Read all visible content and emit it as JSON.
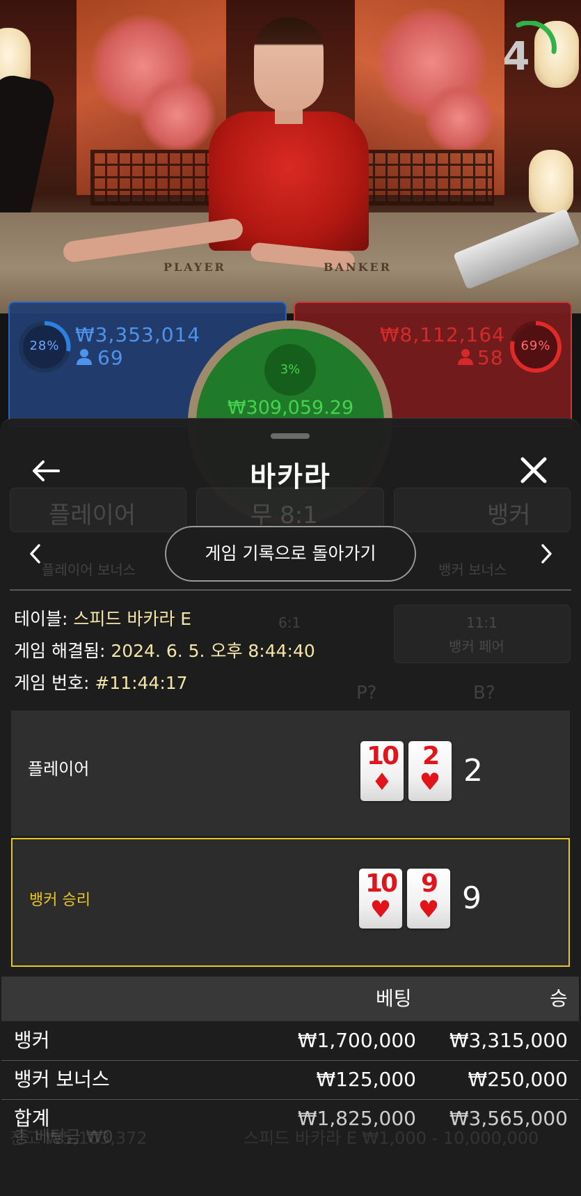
{
  "video": {
    "timer": "4",
    "table_labels": {
      "player": "PLAYER",
      "banker": "BANKER"
    }
  },
  "bet_panels": {
    "player": {
      "percent": "28%",
      "amount": "₩3,353,014",
      "players": "69"
    },
    "banker": {
      "percent": "69%",
      "amount": "₩8,112,164",
      "players": "58"
    },
    "tie": {
      "percent": "3%",
      "amount": "₩309,059.29"
    }
  },
  "sheet": {
    "title": "바카라",
    "history_button": "게임 기록으로 돌아가기",
    "table_info": {
      "table_label": "테이블:",
      "table_value": "스피드 바카라 E",
      "resolved_label": "게임 해결됨:",
      "resolved_value": "2024. 6. 5. 오후 8:44:40",
      "number_label": "게임 번호:",
      "number_value": "#11:44:17"
    },
    "player_result": {
      "label": "플레이어",
      "cards": [
        {
          "rank": "10",
          "suit": "♦"
        },
        {
          "rank": "2",
          "suit": "♥"
        }
      ],
      "score": "2"
    },
    "banker_result": {
      "label": "뱅커 승리",
      "cards": [
        {
          "rank": "10",
          "suit": "♥"
        },
        {
          "rank": "9",
          "suit": "♥"
        }
      ],
      "score": "9"
    },
    "bets_table": {
      "headers": {
        "bet": "베팅",
        "win": "승"
      },
      "rows": [
        {
          "name": "뱅커",
          "bet": "₩1,700,000",
          "win": "₩3,315,000"
        },
        {
          "name": "뱅커 보너스",
          "bet": "₩125,000",
          "win": "₩250,000"
        }
      ],
      "total": {
        "name": "합계",
        "bet": "₩1,825,000",
        "win": "₩3,565,000"
      }
    }
  },
  "background_ghost": {
    "player": "플레이어",
    "tie": "무 8:1",
    "banker": "뱅커",
    "player_bonus": "플레이어 보너스",
    "banker_bonus": "뱅커 보너스",
    "banker_pair_odds": "11:1",
    "banker_pair": "뱅커 페어",
    "perfect_pair_odds": "6:1",
    "p_button": "P?",
    "b_button": "B?",
    "balance": "잔고 ₩5,103,372",
    "game_limits": "스피드 바카라 E ₩1,000 - 10,000,000",
    "bet_total": "총 베팅금 ₩0"
  },
  "colors": {
    "player_blue": "#2d62b8",
    "banker_red": "#c43a3a",
    "tie_green": "#47d24f",
    "winner_gold": "#e7c624",
    "info_value": "#f4e5a8"
  },
  "icons": {
    "back": "arrow-left-icon",
    "close": "close-icon",
    "prev": "chevron-left-icon",
    "next": "chevron-right-icon",
    "user": "user-icon"
  }
}
